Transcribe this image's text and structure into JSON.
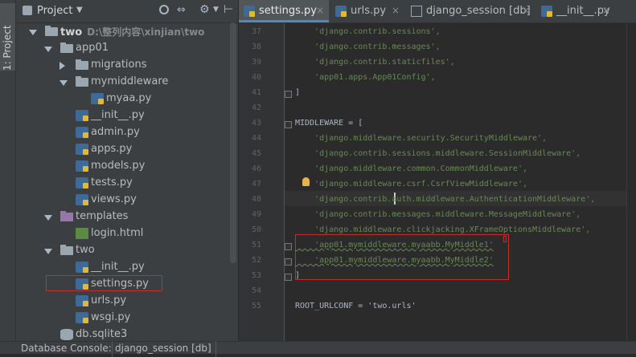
{
  "toolstrip": {
    "label": "1: Project"
  },
  "project": {
    "title": "Project",
    "header_icons": [
      "target-icon",
      "collapse-icon",
      "gear-icon",
      "hide-icon"
    ],
    "tree": [
      {
        "name": "two",
        "path": "D:\\整列内容\\xinjian\\two",
        "depth": 0,
        "type": "folder",
        "expanded": true
      },
      {
        "name": "app01",
        "depth": 1,
        "type": "folder",
        "expanded": true
      },
      {
        "name": "migrations",
        "depth": 2,
        "type": "folder",
        "expanded": false
      },
      {
        "name": "mymiddleware",
        "depth": 2,
        "type": "folder",
        "expanded": true
      },
      {
        "name": "myaa.py",
        "depth": 3,
        "type": "py"
      },
      {
        "name": "__init__.py",
        "depth": 2,
        "type": "py"
      },
      {
        "name": "admin.py",
        "depth": 2,
        "type": "py"
      },
      {
        "name": "apps.py",
        "depth": 2,
        "type": "py"
      },
      {
        "name": "models.py",
        "depth": 2,
        "type": "py"
      },
      {
        "name": "tests.py",
        "depth": 2,
        "type": "py"
      },
      {
        "name": "views.py",
        "depth": 2,
        "type": "py"
      },
      {
        "name": "templates",
        "depth": 1,
        "type": "tmpl",
        "expanded": true
      },
      {
        "name": "login.html",
        "depth": 2,
        "type": "html"
      },
      {
        "name": "two",
        "depth": 1,
        "type": "folder",
        "expanded": true
      },
      {
        "name": "__init__.py",
        "depth": 2,
        "type": "py"
      },
      {
        "name": "settings.py",
        "depth": 2,
        "type": "py",
        "selected": true
      },
      {
        "name": "urls.py",
        "depth": 2,
        "type": "py"
      },
      {
        "name": "wsgi.py",
        "depth": 2,
        "type": "py"
      },
      {
        "name": "db.sqlite3",
        "depth": 1,
        "type": "db"
      }
    ]
  },
  "tabs": [
    {
      "label": "settings.py",
      "active": true,
      "icon": "python-file-icon"
    },
    {
      "label": "urls.py",
      "active": false,
      "icon": "python-file-icon"
    },
    {
      "label": "django_session [db]",
      "active": false,
      "icon": "table-icon"
    },
    {
      "label": "__init__.py",
      "active": false,
      "icon": "python-file-icon"
    }
  ],
  "editor": {
    "lines": [
      {
        "n": "37",
        "text": "    'django.contrib.sessions',",
        "kind": "str"
      },
      {
        "n": "38",
        "text": "    'django.contrib.messages',",
        "kind": "str"
      },
      {
        "n": "39",
        "text": "    'django.contrib.staticfiles',",
        "kind": "str"
      },
      {
        "n": "40",
        "text": "    'app01.apps.App01Config',",
        "kind": "str"
      },
      {
        "n": "41",
        "text": "]",
        "kind": "plain"
      },
      {
        "n": "42",
        "text": "",
        "kind": "plain"
      },
      {
        "n": "43",
        "text": "MIDDLEWARE = [",
        "kind": "plain"
      },
      {
        "n": "44",
        "text": "    'django.middleware.security.SecurityMiddleware',",
        "kind": "str"
      },
      {
        "n": "45",
        "text": "    'django.contrib.sessions.middleware.SessionMiddleware',",
        "kind": "str"
      },
      {
        "n": "46",
        "text": "    'django.middleware.common.CommonMiddleware',",
        "kind": "str"
      },
      {
        "n": "47",
        "text": "    'django.middleware.csrf.CsrfViewMiddleware',",
        "kind": "str"
      },
      {
        "n": "48",
        "text": "    'django.contrib.auth.middleware.AuthenticationMiddleware',",
        "kind": "str"
      },
      {
        "n": "49",
        "text": "    'django.contrib.messages.middleware.MessageMiddleware',",
        "kind": "str"
      },
      {
        "n": "50",
        "text": "    'django.middleware.clickjacking.XFrameOptionsMiddleware',",
        "kind": "str"
      },
      {
        "n": "51",
        "text": "    'app01.mymiddleware.myaabb.MyMiddle1'",
        "kind": "str"
      },
      {
        "n": "52",
        "text": "    'app01.mymiddleware.myaabb.MyMiddle2'",
        "kind": "str"
      },
      {
        "n": "53",
        "text": "]",
        "kind": "plain"
      },
      {
        "n": "54",
        "text": "",
        "kind": "plain"
      },
      {
        "n": "55",
        "text": "ROOT_URLCONF = 'two.urls'",
        "kind": "mixed"
      }
    ]
  },
  "bottom": {
    "console_label": "Database Console:",
    "console_tab": "django_session [db]"
  },
  "colors": {
    "panel_bg": "#3c3f41",
    "editor_bg": "#2b2b2b",
    "string": "#6a8759",
    "highlight_box": "#cc2b2b",
    "active_tab_underline": "#4a88c7"
  }
}
